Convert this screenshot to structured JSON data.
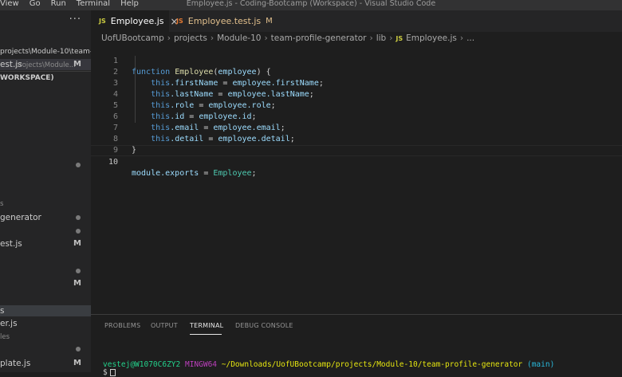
{
  "titlebar": {
    "menu": [
      "View",
      "Go",
      "Run",
      "Terminal",
      "Help"
    ],
    "window_title": "Employee.js - Coding-Bootcamp (Workspace) - Visual Studio Code"
  },
  "sidebar": {
    "more_icon": "ellipsis-icon",
    "open_editor_path": "projects\\Module-10\\team-...",
    "open_editor_file": "est.js",
    "open_editor_file_path": "projects\\Module...",
    "open_editor_badge": "M",
    "workspace_header": "WORKSPACE)",
    "items": [
      {
        "label": "s",
        "kind": "dim"
      },
      {
        "label": "generator",
        "kind": "text"
      },
      {
        "label": "est.js",
        "kind": "text",
        "badge": "M"
      },
      {
        "label": "s",
        "kind": "section"
      },
      {
        "label": "er.js",
        "kind": "text"
      },
      {
        "label": "les",
        "kind": "dim"
      },
      {
        "label": "plate.js",
        "kind": "text",
        "badge": "M"
      }
    ],
    "standalone_badge": "M"
  },
  "tabs": [
    {
      "icon_text": "JS",
      "label": "Employee.js",
      "close": "×",
      "active": true
    },
    {
      "icon_text": "JS",
      "label": "Employee.test.js",
      "status": "M",
      "active": false
    }
  ],
  "breadcrumb": {
    "parts": [
      "UofUBootcamp",
      "projects",
      "Module-10",
      "team-profile-generator",
      "lib"
    ],
    "file_icon": "JS",
    "file": "Employee.js",
    "tail": "..."
  },
  "editor": {
    "line_numbers": [
      "1",
      "2",
      "3",
      "4",
      "5",
      "6",
      "7",
      "8",
      "9",
      "10"
    ],
    "line1": {
      "kw": "function",
      "fn": "Employee",
      "open": "(",
      "param": "employee",
      "close": ") {"
    },
    "assignments": [
      {
        "this": "this",
        "prop": ".firstName",
        "eq": " = ",
        "obj": "employee",
        "val": ".firstName",
        "end": ";"
      },
      {
        "this": "this",
        "prop": ".lastName",
        "eq": " = ",
        "obj": "employee",
        "val": ".lastName",
        "end": ";"
      },
      {
        "this": "this",
        "prop": ".role",
        "eq": " = ",
        "obj": "employee",
        "val": ".role",
        "end": ";"
      },
      {
        "this": "this",
        "prop": ".id",
        "eq": " = ",
        "obj": "employee",
        "val": ".id",
        "end": ";"
      },
      {
        "this": "this",
        "prop": ".email",
        "eq": " = ",
        "obj": "employee",
        "val": ".email",
        "end": ";"
      },
      {
        "this": "this",
        "prop": ".detail",
        "eq": " = ",
        "obj": "employee",
        "val": ".detail",
        "end": ";"
      }
    ],
    "line8": "}",
    "line10": {
      "module": "module",
      "exports": ".exports",
      "eq": " = ",
      "cls": "Employee",
      "end": ";"
    }
  },
  "panel": {
    "tabs": [
      "PROBLEMS",
      "OUTPUT",
      "TERMINAL",
      "DEBUG CONSOLE"
    ],
    "active_tab": "TERMINAL",
    "terminal": {
      "user_host": "vestej@W1070C6ZY2",
      "shell": "MINGW64",
      "path": "~/Downloads/UofUBootcamp/projects/Module-10/team-profile-generator",
      "branch": "(main)",
      "prompt": "$"
    }
  },
  "colors": {
    "editor_bg": "#1e1e1e",
    "sidebar_bg": "#252526",
    "keyword": "#569cd6",
    "function": "#dcdcaa",
    "variable": "#9cdcfe",
    "class": "#4ec9b0",
    "modified": "#e2c08d"
  }
}
